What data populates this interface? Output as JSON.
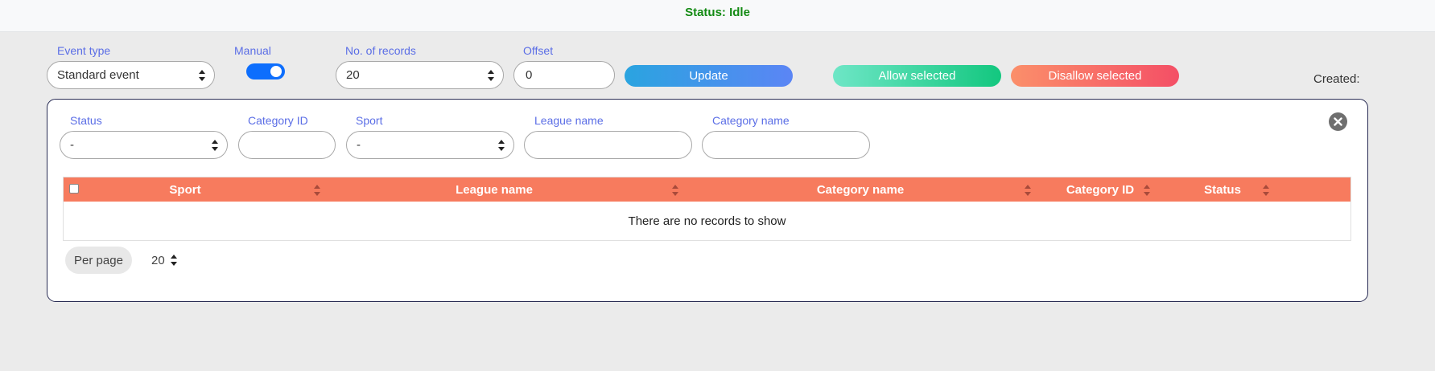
{
  "status_bar": {
    "text": "Status: Idle"
  },
  "controls": {
    "event_type": {
      "label": "Event type",
      "value": "Standard event"
    },
    "manual": {
      "label": "Manual",
      "checked": true
    },
    "records": {
      "label": "No. of records",
      "value": "20"
    },
    "offset": {
      "label": "Offset",
      "value": "0"
    },
    "update_label": "Update",
    "allow_label": "Allow selected",
    "disallow_label": "Disallow selected",
    "created_label": "Created:"
  },
  "filters": {
    "status": {
      "label": "Status",
      "value": "-"
    },
    "category_id": {
      "label": "Category ID",
      "value": ""
    },
    "sport": {
      "label": "Sport",
      "value": "-"
    },
    "league_name": {
      "label": "League name",
      "value": ""
    },
    "category_name": {
      "label": "Category name",
      "value": ""
    }
  },
  "table": {
    "columns": [
      "Sport",
      "League name",
      "Category name",
      "Category ID",
      "Status"
    ],
    "empty_text": "There are no records to show"
  },
  "pagination": {
    "per_page_label": "Per page",
    "per_page_value": "20"
  },
  "colors": {
    "status_green": "#138a13",
    "accent_label": "#5b6ee6",
    "table_header": "#f77b5e",
    "toggle_on": "#0d6efd"
  },
  "icons": {
    "select_arrows": "sort-arrows-icon",
    "close": "close-circle-icon"
  }
}
